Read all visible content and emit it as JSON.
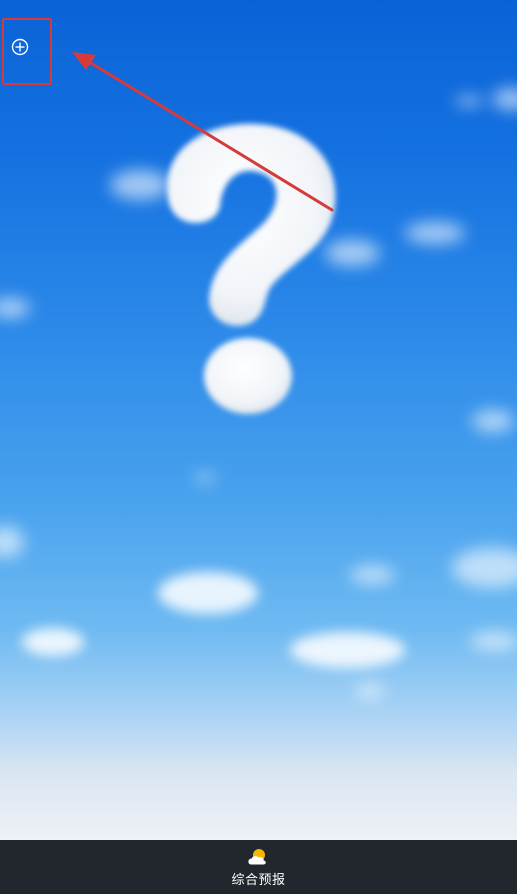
{
  "bottom_nav": {
    "tabs": [
      {
        "label": "综合预报",
        "icon": "sun-cloud-icon",
        "active": true
      }
    ]
  },
  "top_left": {
    "add_button_icon": "plus-circle-icon"
  },
  "background": {
    "scene": "question-mark-cloud-sky"
  },
  "colors": {
    "highlight": "#d63a3a",
    "nav_background": "#22262d",
    "icon_sun": "#f5b800"
  }
}
